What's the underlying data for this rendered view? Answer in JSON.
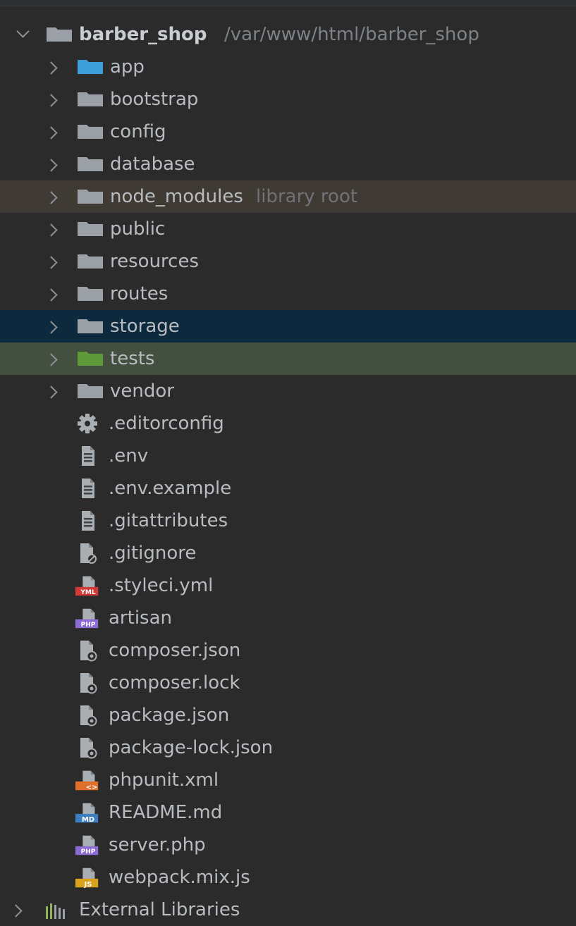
{
  "project": {
    "name": "barber_shop",
    "path": "/var/www/html/barber_shop"
  },
  "folders": [
    {
      "label": "app",
      "icon": "folder-blue-icon"
    },
    {
      "label": "bootstrap",
      "icon": "folder-icon"
    },
    {
      "label": "config",
      "icon": "folder-icon"
    },
    {
      "label": "database",
      "icon": "folder-icon"
    },
    {
      "label": "node_modules",
      "hint": "library root",
      "icon": "folder-icon"
    },
    {
      "label": "public",
      "icon": "folder-icon"
    },
    {
      "label": "resources",
      "icon": "folder-icon"
    },
    {
      "label": "routes",
      "icon": "folder-icon"
    },
    {
      "label": "storage",
      "icon": "folder-icon"
    },
    {
      "label": "tests",
      "icon": "folder-green-icon"
    },
    {
      "label": "vendor",
      "icon": "folder-icon"
    }
  ],
  "files": [
    {
      "label": ".editorconfig",
      "icon": "gear-icon"
    },
    {
      "label": ".env",
      "icon": "text-file-icon"
    },
    {
      "label": ".env.example",
      "icon": "text-file-icon"
    },
    {
      "label": ".gitattributes",
      "icon": "text-file-icon"
    },
    {
      "label": ".gitignore",
      "icon": "ignore-file-icon"
    },
    {
      "label": ".styleci.yml",
      "icon": "yml-file-icon",
      "badge": "YML"
    },
    {
      "label": "artisan",
      "icon": "php-file-icon",
      "badge": "PHP"
    },
    {
      "label": "composer.json",
      "icon": "json-file-icon"
    },
    {
      "label": "composer.lock",
      "icon": "json-file-icon"
    },
    {
      "label": "package.json",
      "icon": "json-file-icon"
    },
    {
      "label": "package-lock.json",
      "icon": "json-file-icon"
    },
    {
      "label": "phpunit.xml",
      "icon": "xml-file-icon",
      "badge": "<>"
    },
    {
      "label": "README.md",
      "icon": "md-file-icon",
      "badge": "MD"
    },
    {
      "label": "server.php",
      "icon": "php-file-icon",
      "badge": "PHP"
    },
    {
      "label": "webpack.mix.js",
      "icon": "js-file-icon",
      "badge": "JS"
    }
  ],
  "external": {
    "label": "External Libraries",
    "icon": "library-icon"
  },
  "colors": {
    "background": "#2b2b2c",
    "library_root_row": "#3f3b34",
    "selected_row": "#0d293e",
    "tests_row": "#44503f",
    "folder_default": "#9aa0a6",
    "folder_blue": "#3d9fd8",
    "folder_green": "#5f9a3a",
    "php_badge": "#8c6bd6",
    "yml_badge": "#d23a3a",
    "xml_badge": "#e06f2a",
    "md_badge": "#3c7fc1",
    "js_badge": "#d9a21b"
  }
}
